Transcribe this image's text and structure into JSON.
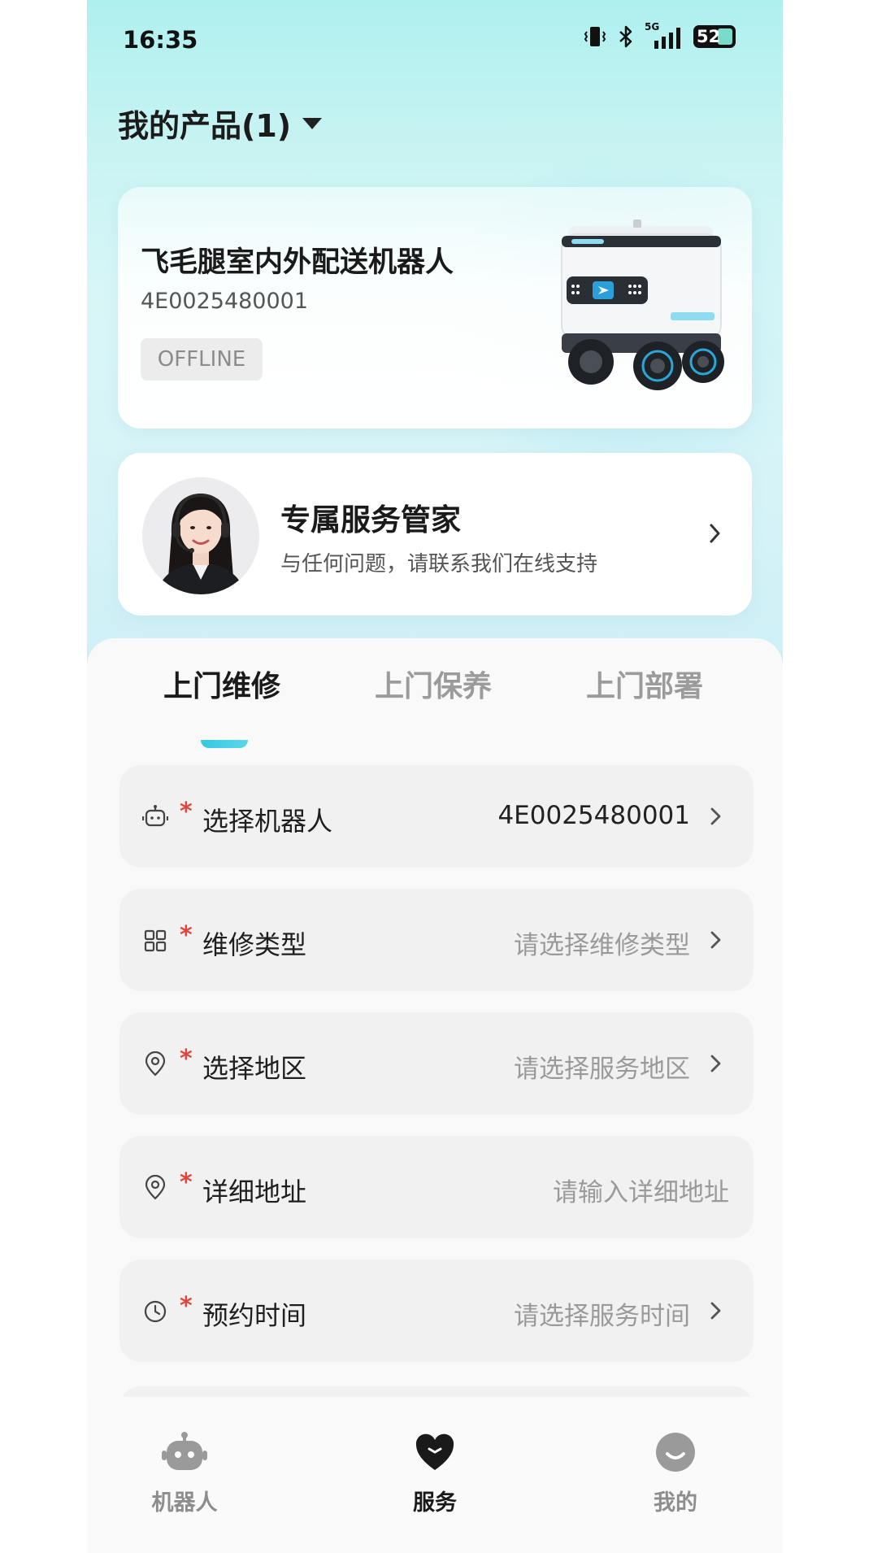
{
  "status_bar": {
    "time": "16:35",
    "network": "5G",
    "battery": "52",
    "icons": [
      "vibrate-icon",
      "bluetooth-icon",
      "signal-icon",
      "battery-icon"
    ]
  },
  "header": {
    "title": "我的产品(1)"
  },
  "product": {
    "name": "飞毛腿室内外配送机器人",
    "serial": "4E0025480001",
    "status": "OFFLINE"
  },
  "manager": {
    "title": "专属服务管家",
    "subtitle": "与任何问题，请联系我们在线支持"
  },
  "tabs": [
    {
      "label": "上门维修",
      "active": true
    },
    {
      "label": "上门保养",
      "active": false
    },
    {
      "label": "上门部署",
      "active": false
    }
  ],
  "form": {
    "required_mark": "*",
    "rows": [
      {
        "icon": "robot-icon",
        "label": "选择机器人",
        "value": "4E0025480001",
        "placeholder": false,
        "arrow": true
      },
      {
        "icon": "grid-icon",
        "label": "维修类型",
        "value": "请选择维修类型",
        "placeholder": true,
        "arrow": true
      },
      {
        "icon": "location-pin-icon",
        "label": "选择地区",
        "value": "请选择服务地区",
        "placeholder": true,
        "arrow": true
      },
      {
        "icon": "location-pin-icon",
        "label": "详细地址",
        "value": "请输入详细地址",
        "placeholder": true,
        "arrow": false
      },
      {
        "icon": "clock-icon",
        "label": "预约时间",
        "value": "请选择服务时间",
        "placeholder": true,
        "arrow": true
      }
    ]
  },
  "bottom_nav": [
    {
      "label": "机器人",
      "icon": "robot-nav-icon",
      "active": false
    },
    {
      "label": "服务",
      "icon": "heart-icon",
      "active": true
    },
    {
      "label": "我的",
      "icon": "smiley-icon",
      "active": false
    }
  ],
  "colors": {
    "accent": "#34c8e0",
    "required": "#e0463b",
    "hero_top": "#aef0ef"
  }
}
